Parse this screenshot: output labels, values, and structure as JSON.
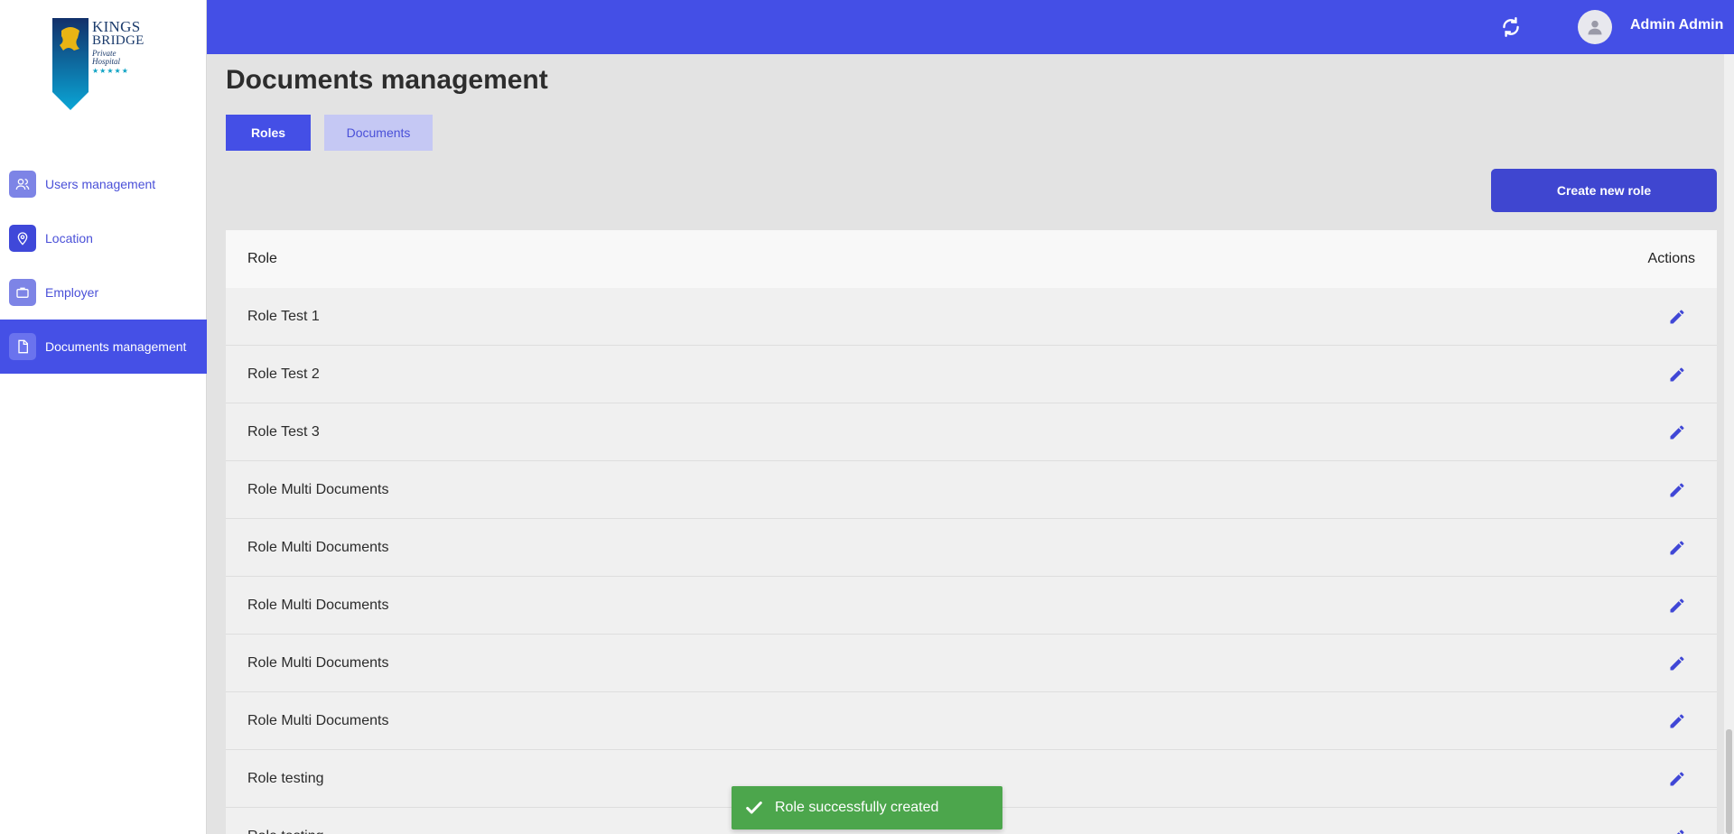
{
  "logo": {
    "line1": "KINGS",
    "line2": "BRIDGE",
    "line3": "Private",
    "line4": "Hospital",
    "stars": "★★★★★"
  },
  "sidebar": {
    "items": [
      {
        "label": "Users management",
        "icon": "users-icon"
      },
      {
        "label": "Location",
        "icon": "map-pin-icon"
      },
      {
        "label": "Employer",
        "icon": "briefcase-icon"
      },
      {
        "label": "Documents management",
        "icon": "document-icon",
        "active": true
      }
    ]
  },
  "header": {
    "user_name": "Admin Admin",
    "sync_icon": "refresh-icon",
    "avatar_icon": "user-avatar-icon"
  },
  "main": {
    "title": "Documents management",
    "tabs": [
      {
        "label": "Roles",
        "active": true
      },
      {
        "label": "Documents",
        "active": false
      }
    ],
    "create_button": "Create new role"
  },
  "table": {
    "columns": [
      "Role",
      "Actions"
    ],
    "rows": [
      "Role Test 1",
      "Role Test 2",
      "Role Test 3",
      "Role Multi Documents",
      "Role Multi Documents",
      "Role Multi Documents",
      "Role Multi Documents",
      "Role Multi Documents",
      "Role testing",
      "Role testing"
    ]
  },
  "toast": {
    "message": "Role successfully created"
  },
  "colors": {
    "primary": "#444fe6",
    "button": "#3f46d0",
    "success": "#4ca64c"
  }
}
